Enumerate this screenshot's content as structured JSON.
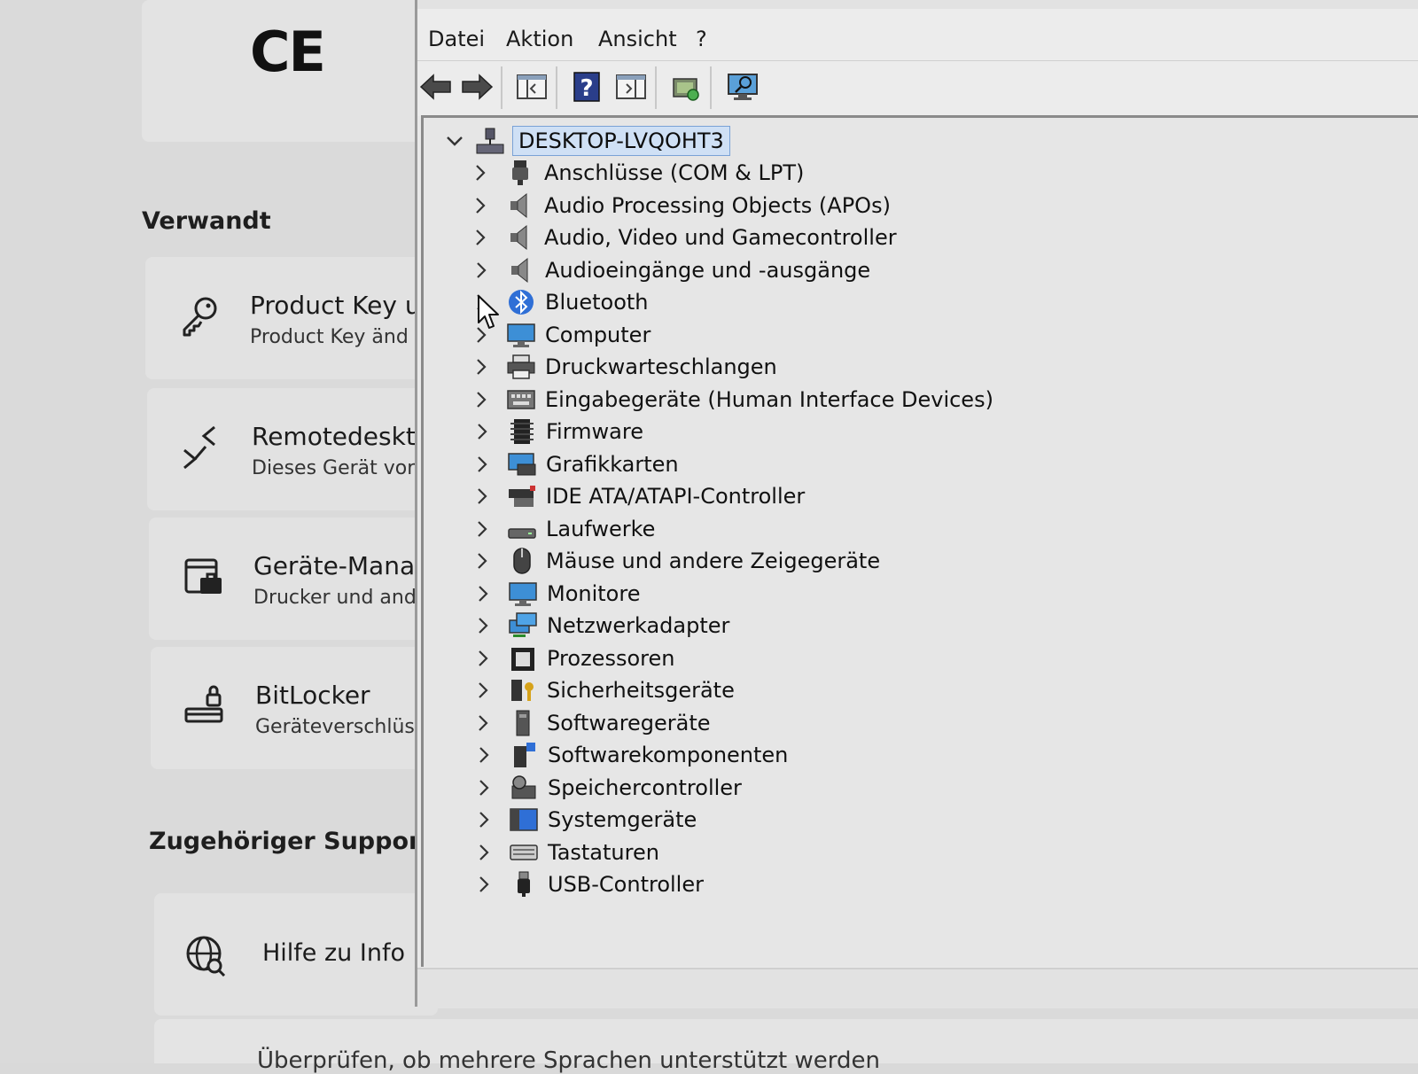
{
  "settings": {
    "ce_mark": "CE",
    "related_title": "Verwandt",
    "cards": [
      {
        "title": "Product Key u",
        "subtitle": "Product Key änd",
        "icon": "key-icon"
      },
      {
        "title": "Remotedeskto",
        "subtitle": "Dieses Gerät vor",
        "icon": "remote-desktop-icon"
      },
      {
        "title": "Geräte-Manag",
        "subtitle": "Drucker und and",
        "icon": "device-manager-icon"
      },
      {
        "title": "BitLocker",
        "subtitle": "Geräteverschlüs",
        "icon": "bitlocker-icon"
      }
    ],
    "support_title": "Zugehöriger Support",
    "support_card": {
      "title": "Hilfe zu Info",
      "icon": "globe-icon"
    },
    "bottom_text": "Überprüfen, ob mehrere Sprachen unterstützt werden"
  },
  "devmgr": {
    "menu": [
      "Datei",
      "Aktion",
      "Ansicht",
      "?"
    ],
    "toolbar": [
      {
        "name": "back-icon"
      },
      {
        "name": "forward-icon"
      },
      {
        "name": "show-hide-console-tree-icon"
      },
      {
        "name": "help-icon"
      },
      {
        "name": "show-hide-action-pane-icon"
      },
      {
        "name": "update-driver-icon"
      },
      {
        "name": "scan-hardware-icon"
      }
    ],
    "root": {
      "label": "DESKTOP-LVQOHT3",
      "icon": "computer-tree-icon"
    },
    "categories": [
      {
        "label": "Anschlüsse (COM & LPT)",
        "icon": "port-icon"
      },
      {
        "label": "Audio Processing Objects (APOs)",
        "icon": "speaker-icon"
      },
      {
        "label": "Audio, Video und Gamecontroller",
        "icon": "speaker-icon"
      },
      {
        "label": "Audioeingänge und -ausgänge",
        "icon": "speaker-icon"
      },
      {
        "label": "Bluetooth",
        "icon": "bluetooth-icon"
      },
      {
        "label": "Computer",
        "icon": "monitor-icon"
      },
      {
        "label": "Druckwarteschlangen",
        "icon": "printer-icon"
      },
      {
        "label": "Eingabegeräte (Human Interface Devices)",
        "icon": "hid-icon"
      },
      {
        "label": "Firmware",
        "icon": "firmware-icon"
      },
      {
        "label": "Grafikkarten",
        "icon": "display-adapter-icon"
      },
      {
        "label": "IDE ATA/ATAPI-Controller",
        "icon": "ide-controller-icon"
      },
      {
        "label": "Laufwerke",
        "icon": "drive-icon"
      },
      {
        "label": "Mäuse und andere Zeigegeräte",
        "icon": "mouse-icon"
      },
      {
        "label": "Monitore",
        "icon": "monitor-icon"
      },
      {
        "label": "Netzwerkadapter",
        "icon": "network-adapter-icon"
      },
      {
        "label": "Prozessoren",
        "icon": "processor-icon"
      },
      {
        "label": "Sicherheitsgeräte",
        "icon": "security-device-icon"
      },
      {
        "label": "Softwaregeräte",
        "icon": "software-device-icon"
      },
      {
        "label": "Softwarekomponenten",
        "icon": "software-component-icon"
      },
      {
        "label": "Speichercontroller",
        "icon": "storage-controller-icon"
      },
      {
        "label": "Systemgeräte",
        "icon": "system-device-icon"
      },
      {
        "label": "Tastaturen",
        "icon": "keyboard-icon"
      },
      {
        "label": "USB-Controller",
        "icon": "usb-icon"
      }
    ]
  }
}
